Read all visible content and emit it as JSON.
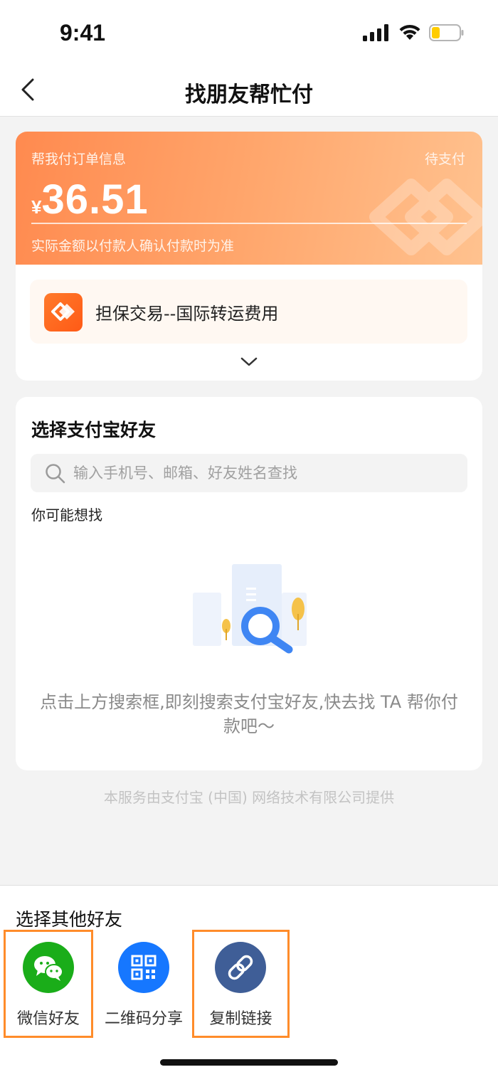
{
  "status_bar": {
    "time": "9:41"
  },
  "nav": {
    "title": "找朋友帮忙付"
  },
  "order": {
    "header_label": "帮我付订单信息",
    "status": "待支付",
    "currency": "¥",
    "amount": "36.51",
    "note": "实际金额以付款人确认付款时为准",
    "item_name": "担保交易--国际转运费用"
  },
  "friends": {
    "title": "选择支付宝好友",
    "search_placeholder": "输入手机号、邮箱、好友姓名查找",
    "suggest_label": "你可能想找",
    "empty_text": "点击上方搜索框,即刻搜索支付宝好友,快去找 TA 帮你付款吧～"
  },
  "provider": "本服务由支付宝 (中国) 网络技术有限公司提供",
  "share": {
    "title": "选择其他好友",
    "items": [
      {
        "label": "微信好友",
        "icon": "wechat-icon",
        "color": "#1aad19"
      },
      {
        "label": "二维码分享",
        "icon": "qr-code-icon",
        "color": "#1677ff"
      },
      {
        "label": "复制链接",
        "icon": "link-icon",
        "color": "#3f5e97"
      }
    ]
  },
  "colors": {
    "accent_orange": "#ff8c4a",
    "highlight_border": "#ff8c2a"
  }
}
